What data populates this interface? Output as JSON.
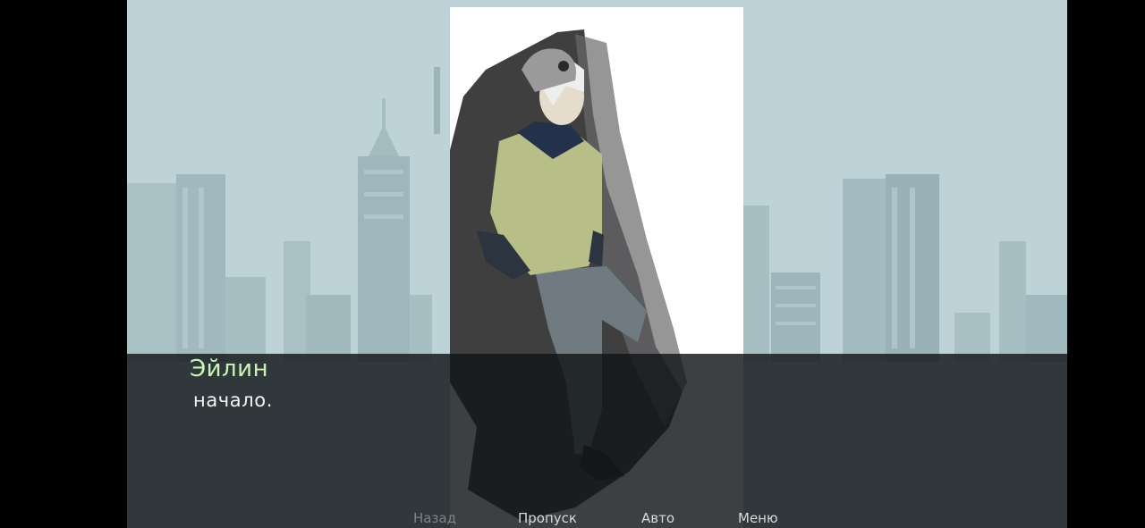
{
  "dialogue": {
    "speaker": "Эйлин",
    "text": "начало.",
    "speaker_color": "#c6f7b2"
  },
  "quick_menu": [
    {
      "label": "Назад",
      "enabled": false
    },
    {
      "label": "Пропуск",
      "enabled": true
    },
    {
      "label": "Авто",
      "enabled": true
    },
    {
      "label": "Меню",
      "enabled": true
    }
  ],
  "background": {
    "scene": "city-skyline-background"
  },
  "character": {
    "sprite": "character-sprite"
  }
}
